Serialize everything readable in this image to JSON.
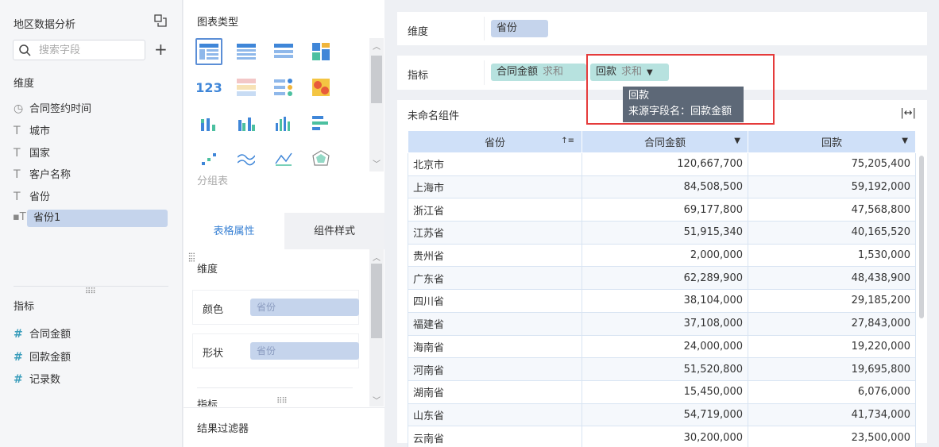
{
  "left_panel": {
    "title": "地区数据分析",
    "search_placeholder": "搜索字段",
    "dimension_label": "维度",
    "dimension_fields": [
      "合同签约时间",
      "城市",
      "国家",
      "客户名称",
      "省份"
    ],
    "active_field": "省份1",
    "measure_label": "指标",
    "measure_fields": [
      "合同金额",
      "回款金额",
      "记录数"
    ]
  },
  "middle_panel": {
    "chart_type_label": "图表类型",
    "group_table_label": "分组表",
    "tabs": [
      "表格属性",
      "组件样式"
    ],
    "dimension_label": "维度",
    "color_label": "颜色",
    "color_value": "省份",
    "shape_label": "形状",
    "shape_value": "省份",
    "measure_label_partial": "指标",
    "result_filter_label": "结果过滤器"
  },
  "right_panel": {
    "dimension_label": "维度",
    "dimension_pill": "省份",
    "measure_label": "指标",
    "measure_pill_1": {
      "name": "合同金额",
      "agg": "求和"
    },
    "measure_pill_2": {
      "name": "回款",
      "agg": "求和"
    },
    "tooltip": {
      "line1": "回款",
      "line2": "来源字段名：回款金额"
    },
    "widget_title": "未命名组件",
    "table": {
      "headers": [
        "省份",
        "合同金额",
        "回款"
      ],
      "rows": [
        [
          "北京市",
          "120,667,700",
          "75,205,400"
        ],
        [
          "上海市",
          "84,508,500",
          "59,192,000"
        ],
        [
          "浙江省",
          "69,177,800",
          "47,568,800"
        ],
        [
          "江苏省",
          "51,915,340",
          "40,165,520"
        ],
        [
          "贵州省",
          "2,000,000",
          "1,530,000"
        ],
        [
          "广东省",
          "62,289,900",
          "48,438,900"
        ],
        [
          "四川省",
          "38,104,000",
          "29,185,200"
        ],
        [
          "福建省",
          "37,108,000",
          "27,843,000"
        ],
        [
          "海南省",
          "24,000,000",
          "19,220,000"
        ],
        [
          "河南省",
          "51,520,800",
          "19,695,800"
        ],
        [
          "湖南省",
          "15,450,000",
          "6,076,000"
        ],
        [
          "山东省",
          "54,719,000",
          "41,734,000"
        ],
        [
          "云南省",
          "30,200,000",
          "23,500,000"
        ]
      ]
    }
  },
  "colors": {
    "accent": "#3a82d4",
    "highlight_box": "#e53b3b",
    "header_bg": "#cfe0f8"
  }
}
